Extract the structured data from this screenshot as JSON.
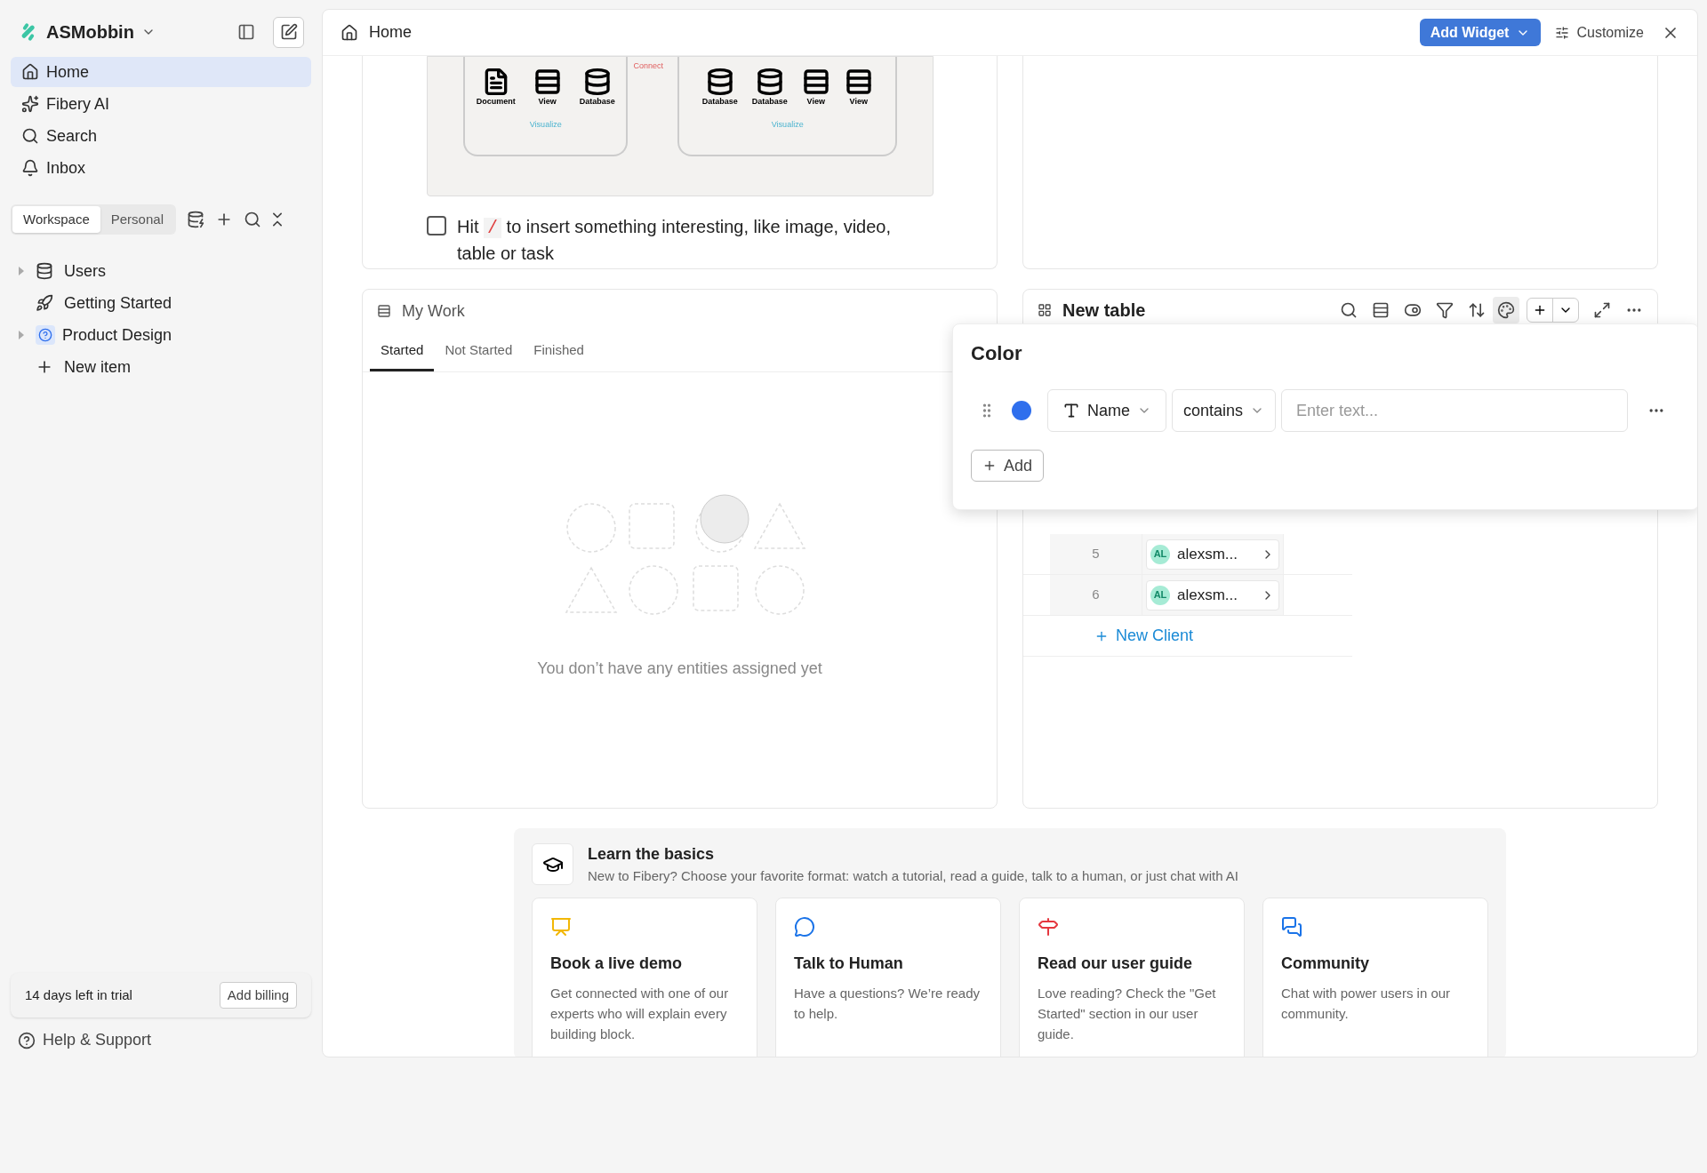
{
  "sidebar": {
    "workspace_name": "ASMobbin",
    "nav": [
      {
        "label": "Home",
        "selected": true
      },
      {
        "label": "Fibery AI",
        "selected": false
      },
      {
        "label": "Search",
        "selected": false
      },
      {
        "label": "Inbox",
        "selected": false
      }
    ],
    "scope_tabs": [
      {
        "label": "Workspace",
        "selected": true
      },
      {
        "label": "Personal",
        "selected": false
      }
    ],
    "tree": [
      {
        "label": "Users",
        "expandable": true
      },
      {
        "label": "Getting Started",
        "expandable": false
      },
      {
        "label": "Product Design",
        "expandable": true
      },
      {
        "label": "New item",
        "expandable": false
      }
    ],
    "trial": {
      "text": "14 days left in trial",
      "button": "Add billing"
    },
    "help": "Help & Support"
  },
  "header": {
    "title": "Home",
    "add_widget": "Add Widget",
    "customize": "Customize"
  },
  "doc_widget": {
    "diagram": {
      "left": [
        "Document",
        "View",
        "Database"
      ],
      "right": [
        "Database",
        "Database",
        "View",
        "View"
      ],
      "connect": "Connect",
      "visualize_left": "Visualize",
      "visualize_right": "Visualize"
    },
    "todo": {
      "checked": false,
      "before": "Hit",
      "key": "/",
      "after": "to insert something interesting, like image, video, table or task"
    }
  },
  "my_work": {
    "title": "My Work",
    "tabs": [
      {
        "label": "Started",
        "selected": true
      },
      {
        "label": "Not Started",
        "selected": false
      },
      {
        "label": "Finished",
        "selected": false
      }
    ],
    "empty": "You don’t have any entities assigned yet"
  },
  "new_table": {
    "title": "New table",
    "rows": [
      {
        "number": "5",
        "avatar": "AL",
        "name": "alexsm..."
      },
      {
        "number": "6",
        "avatar": "AL",
        "name": "alexsm..."
      }
    ],
    "new_row": "New Client"
  },
  "color_popup": {
    "title": "Color",
    "rule": {
      "color": "#2f6fed",
      "field": "Name",
      "operator": "contains",
      "placeholder": "Enter text..."
    },
    "add": "Add"
  },
  "learn": {
    "title": "Learn the basics",
    "subtitle": "New to Fibery? Choose your favorite format: watch a tutorial, read a guide, talk to a human, or just chat with AI",
    "cards": [
      {
        "kind": "demo",
        "color": "#f2b705",
        "title": "Book a live demo",
        "text": "Get connected with one of our experts who will explain every building block."
      },
      {
        "kind": "human",
        "color": "#1a73e8",
        "title": "Talk to Human",
        "text": "Have a questions? We’re ready to help."
      },
      {
        "kind": "guide",
        "color": "#e5373f",
        "title": "Read our user guide",
        "text": "Love reading? Check the \"Get Started\" section in our user guide."
      },
      {
        "kind": "community",
        "color": "#1a73e8",
        "title": "Community",
        "text": "Chat with power users in our community."
      }
    ]
  }
}
